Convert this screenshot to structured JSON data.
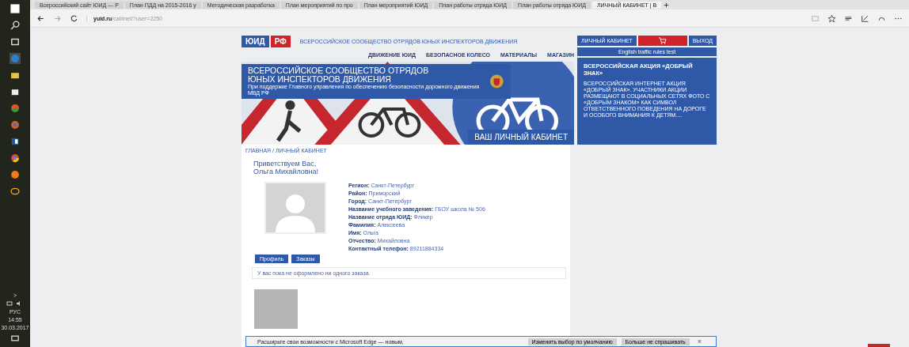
{
  "taskbar": {
    "tray_arrow": ">",
    "language": "РУС",
    "time": "14:55",
    "date": "30.03.2017"
  },
  "browser": {
    "tabs": [
      {
        "title": "Всероссийский сайт ЮИД — Р",
        "selected": false
      },
      {
        "title": "План ПДД на 2015-2016 у",
        "selected": false
      },
      {
        "title": "Методическая разработка",
        "selected": false
      },
      {
        "title": "План мероприятий по про",
        "selected": false
      },
      {
        "title": "План мероприятий ЮИД",
        "selected": false
      },
      {
        "title": "План работы отряда ЮИД",
        "selected": false
      },
      {
        "title": "План работы отряда ЮИД",
        "selected": false
      },
      {
        "title": "ЛИЧНЫЙ КАБИНЕТ | В",
        "selected": true
      }
    ],
    "url_host": "yuid.ru",
    "url_path": "/cabinet/?user=2250"
  },
  "site": {
    "logo_left": "ЮИД",
    "logo_right": "РФ",
    "tagline": "ВСЕРОССИЙСКОЕ СООБЩЕСТВО ОТРЯДОВ ЮНЫХ ИНСПЕКТОРОВ ДВИЖЕНИЯ",
    "nav": [
      "ДВИЖЕНИЕ ЮИД",
      "БЕЗОПАСНОЕ КОЛЕСО",
      "МАТЕРИАЛЫ",
      "МАГАЗИН"
    ],
    "account_link": "ЛИЧНЫЙ КАБИНЕТ",
    "logout": "ВЫХОД",
    "english_test": "English traffic rules test",
    "banner": {
      "title_1": "ВСЕРОССИЙСКОЕ СООБЩЕСТВО ОТРЯДОВ",
      "title_2": "ЮНЫХ ИНСПЕКТОРОВ ДВИЖЕНИЯ",
      "subtitle": "При поддержке Главного управления по обеспечению безопасности дорожного движения МВД РФ",
      "caption": "ВАШ ЛИЧНЫЙ КАБИНЕТ"
    },
    "promo": {
      "title": "ВСЕРОССИЙСКАЯ АКЦИЯ «ДОБРЫЙ ЗНАК»",
      "text": "ВСЕРОССИЙСКАЯ ИНТЕРНЕТ АКЦИЯ «ДОБРЫЙ ЗНАК». УЧАСТНИКИ АКЦИИ РАЗМЕЩАЮТ В СОЦИАЛЬНЫХ СЕТЯХ ФОТО С «ДОБРЫМ ЗНАКОМ» КАК СИМВОЛ ОТВЕТСТВЕННОГО ПОВЕДЕНИЯ НА ДОРОГЕ И ОСОБОГО ВНИМАНИЯ К ДЕТЯМ...."
    }
  },
  "breadcrumb": "ГЛАВНАЯ / ЛИЧНЫЙ КАБИНЕТ",
  "greeting": [
    "Приветствуем Вас,",
    "Ольга Михайловна!"
  ],
  "profile_fields": [
    {
      "label": "Регион:",
      "value": "Санкт-Петербург"
    },
    {
      "label": "Район:",
      "value": "Приморский"
    },
    {
      "label": "Город:",
      "value": "Санкт-Петербург"
    },
    {
      "label": "Название учебного заведения:",
      "value": "ГБОУ школа № 506"
    },
    {
      "label": "Название отряда ЮИД:",
      "value": "Фликер"
    },
    {
      "label": "Фамилия:",
      "value": "Алексеева"
    },
    {
      "label": "Имя:",
      "value": "Ольга"
    },
    {
      "label": "Отчество:",
      "value": "Михайловна"
    },
    {
      "label": "Контактный телефон:",
      "value": "89211884334"
    }
  ],
  "buttons": [
    "Профиль",
    "Заказы"
  ],
  "orders_message": "У вас пока не оформлено ни одного заказа.",
  "edge_bar": {
    "text": "Расширьте свои возможности с Microsoft Edge — новым,",
    "buttons": [
      "Изменить выбор по умолчанию",
      "Больше не спрашивать"
    ],
    "close": "×"
  }
}
